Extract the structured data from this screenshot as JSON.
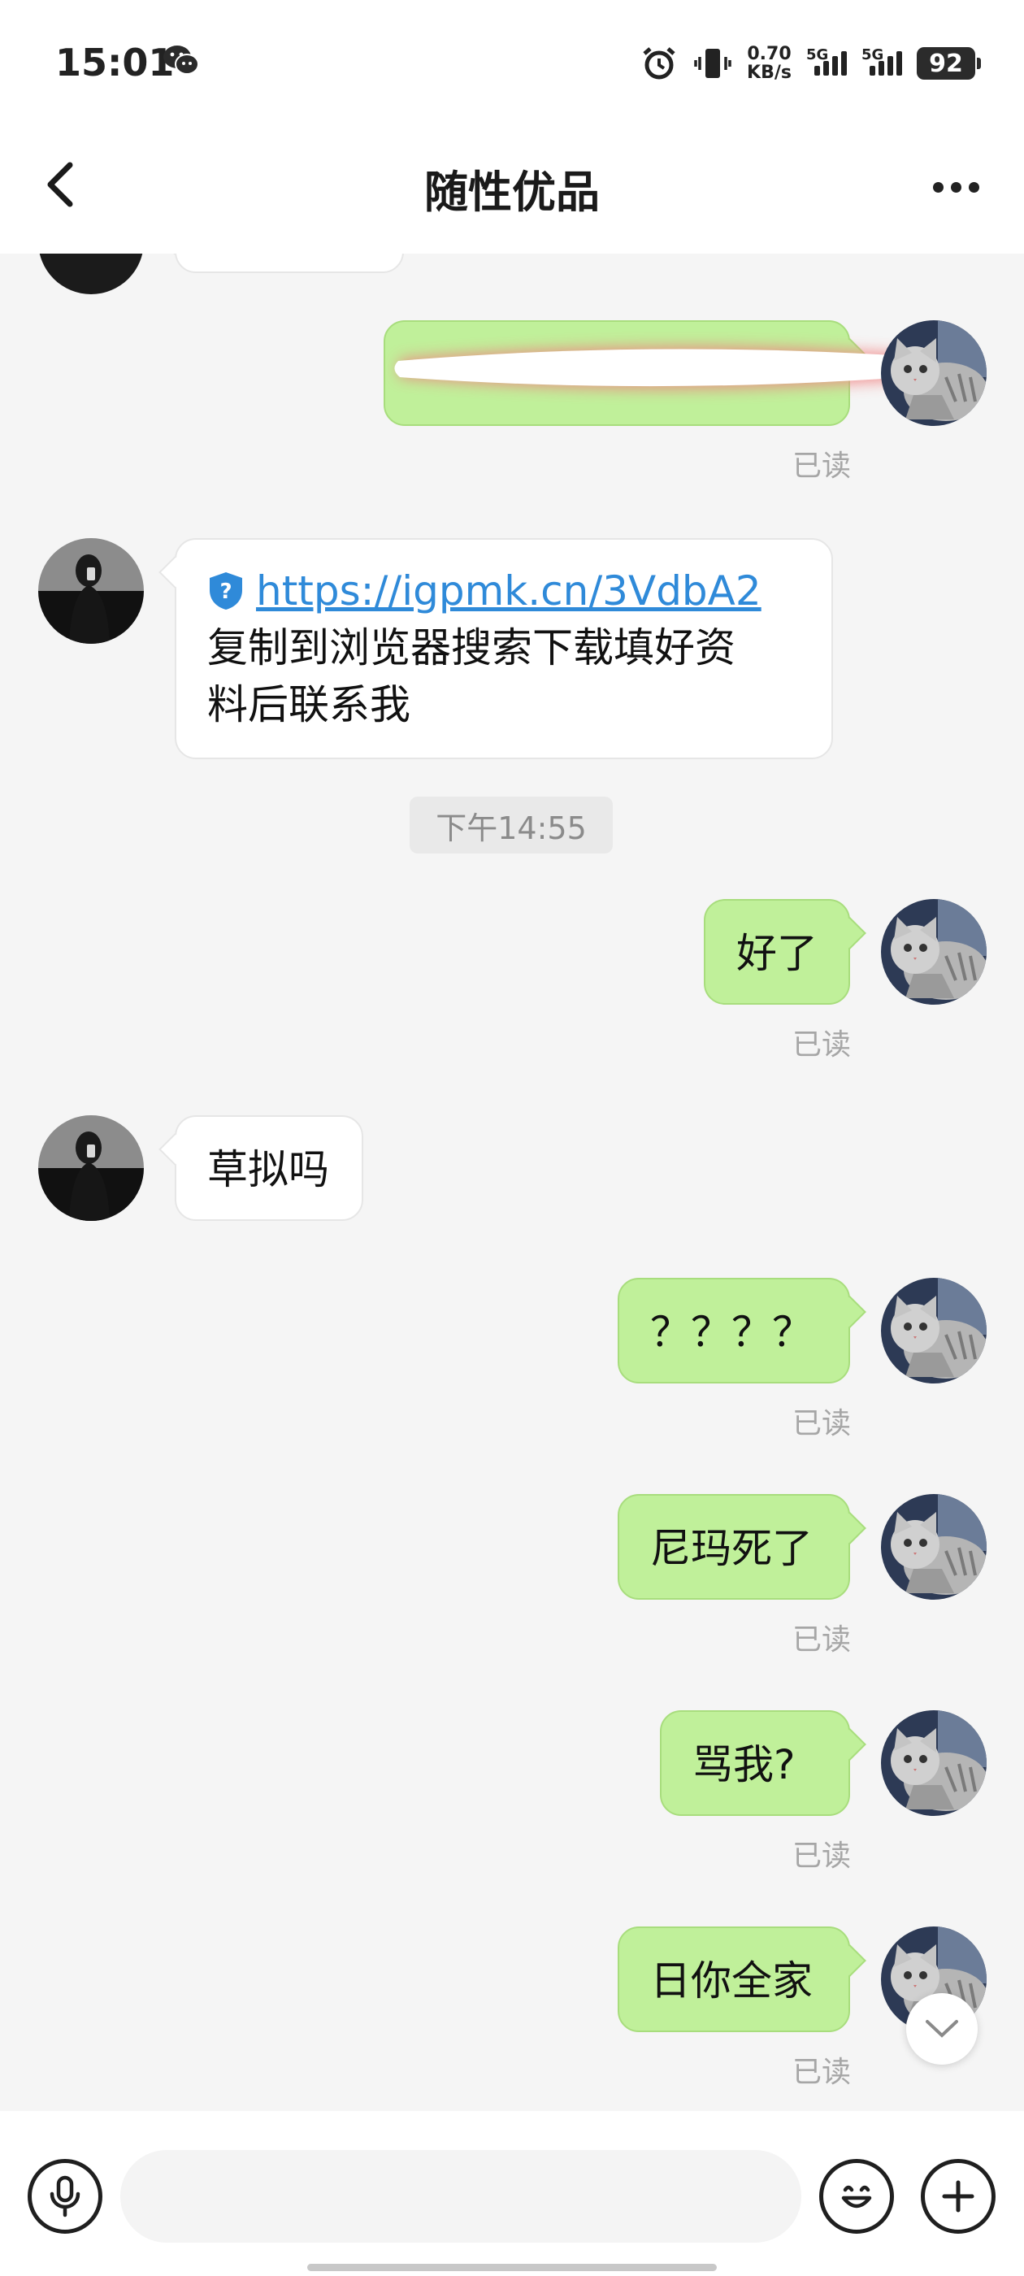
{
  "status_bar": {
    "time": "15:01",
    "network_speed_value": "0.70",
    "network_speed_unit": "KB/s",
    "sim1_label": "5G",
    "sim2_label": "5G",
    "battery": "92",
    "icons": [
      "wechat-icon",
      "alarm-icon",
      "vibrate-icon",
      "signal-icon",
      "battery-icon"
    ]
  },
  "header": {
    "title": "随性优品",
    "back_icon": "chevron-left-icon",
    "more_icon": "more-dots-icon"
  },
  "messages": [
    {
      "from": "me",
      "text": "",
      "redacted": true,
      "read_label": "已读"
    },
    {
      "from": "them",
      "link": "https://igpmk.cn/3VdbA2",
      "text_line1": "复制到浏览器搜索下载填好资",
      "text_line2": "料后联系我"
    },
    {
      "type": "timestamp",
      "text": "下午14:55"
    },
    {
      "from": "me",
      "text": "好了",
      "read_label": "已读"
    },
    {
      "from": "them",
      "text": "草拟吗"
    },
    {
      "from": "me",
      "text": "？？？？",
      "read_label": "已读"
    },
    {
      "from": "me",
      "text": "尼玛死了",
      "read_label": "已读"
    },
    {
      "from": "me",
      "text": "骂我?",
      "read_label": "已读"
    },
    {
      "from": "me",
      "text": "日你全家",
      "read_label": "已读"
    }
  ],
  "colors": {
    "outgoing_bubble": "#c0f09a",
    "incoming_bubble": "#ffffff",
    "link": "#2f8ad9",
    "background": "#f5f5f5"
  },
  "input_bar": {
    "voice_icon": "microphone-icon",
    "emoji_icon": "emoji-icon",
    "plus_icon": "plus-icon",
    "placeholder": ""
  }
}
